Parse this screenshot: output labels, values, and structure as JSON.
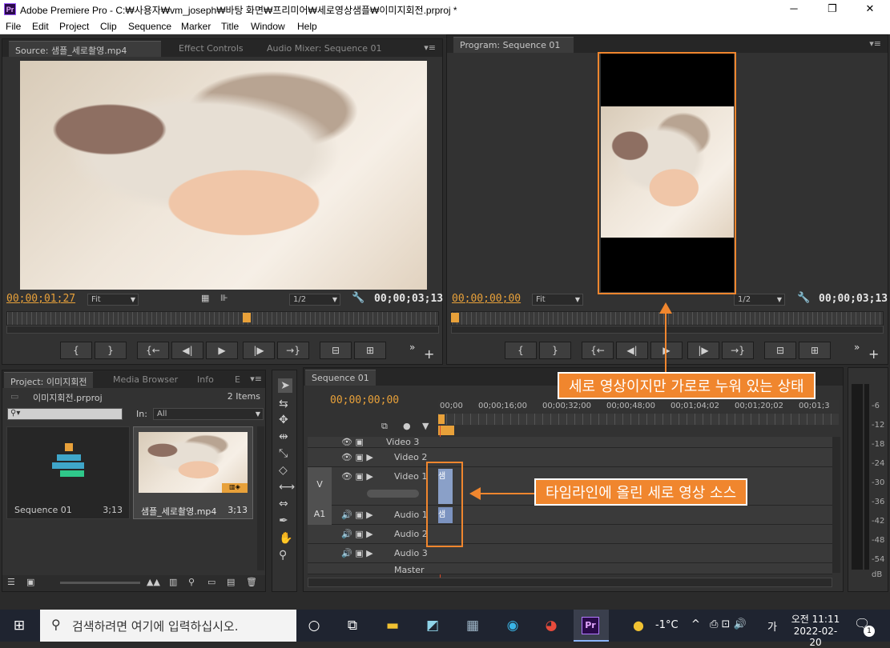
{
  "window": {
    "app_icon": "Pr",
    "title": "Adobe Premiere Pro - C:₩사용자₩vm_joseph₩바탕 화면₩프리미어₩세로영상샘플₩이미지회전.prproj *",
    "controls": [
      "─",
      "❐",
      "✕"
    ]
  },
  "menu": [
    "File",
    "Edit",
    "Project",
    "Clip",
    "Sequence",
    "Marker",
    "Title",
    "Window",
    "Help"
  ],
  "source_panel": {
    "tabs": [
      "Source: 샘플_세로촬영.mp4",
      "Effect Controls",
      "Audio Mixer: Sequence 01"
    ],
    "timecode_in": "00;00;01;27",
    "fit": "Fit",
    "resolution": "1/2",
    "timecode_out": "00;00;03;13"
  },
  "program_panel": {
    "tab": "Program: Sequence 01",
    "timecode_in": "00;00;00;00",
    "fit": "Fit",
    "resolution": "1/2",
    "timecode_out": "00;00;03;13"
  },
  "controls": [
    "{",
    "}",
    "{←",
    "◀|",
    "▶",
    "|▶",
    "→}",
    "⊟",
    "⊞"
  ],
  "project_panel": {
    "tabs": [
      "Project: 이미지회전",
      "Media Browser",
      "Info",
      "E"
    ],
    "file": "이미지회전.prproj",
    "count": "2 Items",
    "in_label": "In:",
    "in_value": "All",
    "items": [
      {
        "name": "Sequence 01",
        "duration": "3;13"
      },
      {
        "name": "샘플_세로촬영.mp4",
        "duration": "3;13"
      }
    ]
  },
  "timeline": {
    "tab": "Sequence 01",
    "timecode": "00;00;00;00",
    "ruler": [
      "00;00",
      "00;00;16;00",
      "00;00;32;00",
      "00;00;48;00",
      "00;01;04;02",
      "00;01;20;02",
      "00;01;3"
    ],
    "tracks": [
      {
        "id": "",
        "name": "Video 3"
      },
      {
        "id": "",
        "name": "Video 2"
      },
      {
        "id": "V",
        "name": "Video 1"
      },
      {
        "id": "A1",
        "name": "Audio 1"
      },
      {
        "id": "",
        "name": "Audio 2"
      },
      {
        "id": "",
        "name": "Audio 3"
      },
      {
        "id": "",
        "name": "Master"
      }
    ],
    "clip_label": "샘"
  },
  "meter": {
    "scale": [
      "-6",
      "-12",
      "-18",
      "-24",
      "-30",
      "-36",
      "-42",
      "-48",
      "-54",
      "dB"
    ]
  },
  "annotations": {
    "program": "세로 영상이지만 가로로 누워 있는 상태",
    "timeline": "타임라인에 올린 세로 영상 소스"
  },
  "taskbar": {
    "search_placeholder": "검색하려면 여기에 입력하십시오.",
    "weather": "-1°C",
    "ime": "가",
    "time": "오전 11:11",
    "date": "2022-02-20",
    "notification_count": "1"
  },
  "colors": {
    "accent": "#f0862e",
    "timecode": "#e8a13a",
    "panel": "#323232"
  }
}
